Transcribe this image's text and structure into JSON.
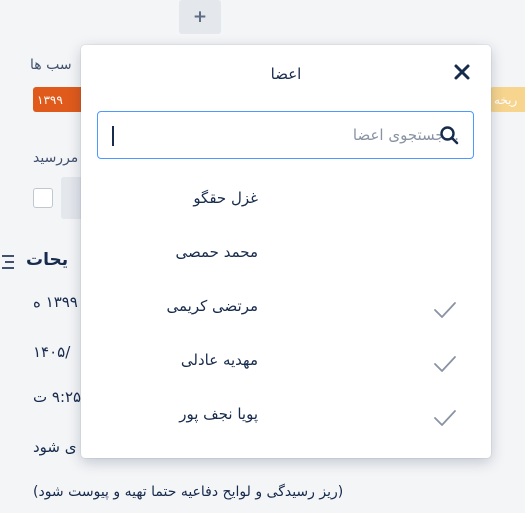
{
  "background": {
    "lbl_top": "سب ها",
    "badge_left": "۱۳۹۹",
    "badge_right": "ریخه",
    "lbl_due": "مررسید",
    "section_heading": "یحات",
    "line1": "۱۳۹۹ ه",
    "line2": "/۱۴۰۵",
    "line3": "۹:۲۵ ت",
    "line4": "ی شود",
    "line5": "(ریز رسیدگی و لوایح دفاعیه حتما تهیه و پیوست شود)",
    "add_symbol": "+"
  },
  "popup": {
    "title": "اعضا",
    "search": {
      "placeholder": "...جستجوی اعضا",
      "value": ""
    },
    "members": [
      {
        "name": "غزل حقگو",
        "checked": false
      },
      {
        "name": "محمد حمصی",
        "checked": false
      },
      {
        "name": "مرتضی کریمی",
        "checked": true
      },
      {
        "name": "مهدیه عادلی",
        "checked": true
      },
      {
        "name": "پویا نجف پور",
        "checked": true
      }
    ]
  },
  "colors": {
    "accent": "#4c9aff",
    "badge_orange": "#e05a1c",
    "badge_yellow": "#f7d58e",
    "check_gray": "#8993a4"
  }
}
